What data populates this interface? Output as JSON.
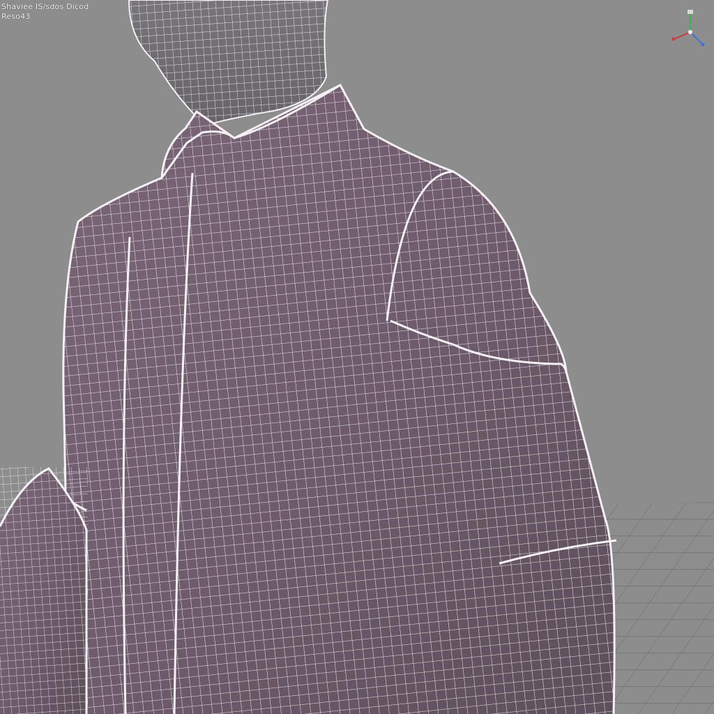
{
  "viewport": {
    "hud_line_1": "Shaviee IS/sdos Dicod",
    "hud_line_2": "Reso43"
  },
  "colors": {
    "background": "#8d8d8d",
    "ground_grid": "#777777",
    "shirt_fill": "#6f5b6c",
    "skin_fill": "#6d6a70",
    "wireframe": "#f2eef2",
    "axis_x": "#d03a3a",
    "axis_y": "#35b84a",
    "axis_z": "#3f73d8"
  },
  "model": {
    "type": "wireframe-character-shirt",
    "shading": "smooth-wireframe-overlay"
  },
  "gizmo": {
    "axes": [
      "x",
      "y",
      "z"
    ],
    "icon": "axis-gizmo-icon"
  }
}
